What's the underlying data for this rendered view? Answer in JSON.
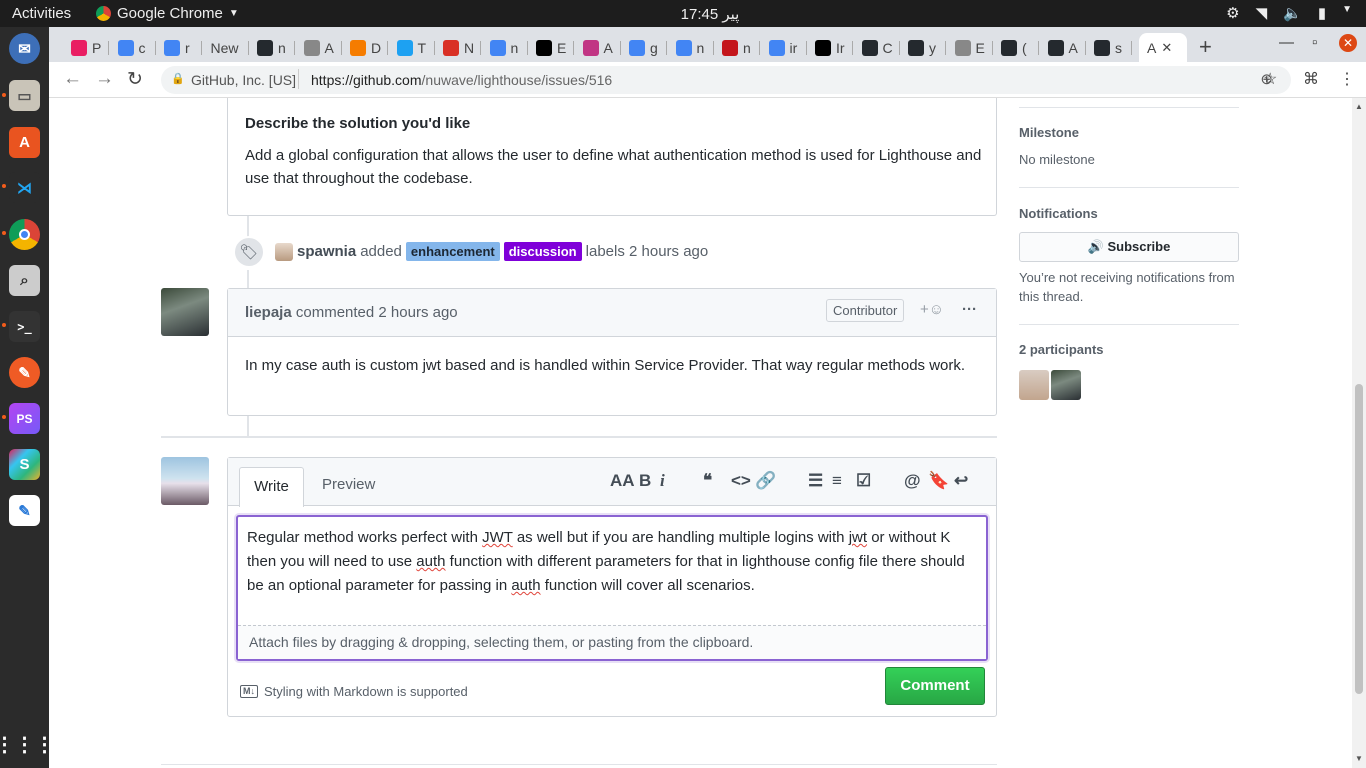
{
  "os": {
    "activities": "Activities",
    "app_name": "Google Chrome",
    "clock": "17:45 پير"
  },
  "browser": {
    "tabs": [
      {
        "label": "P",
        "color": "#e91e63"
      },
      {
        "label": "c",
        "color": "#4285f4"
      },
      {
        "label": "r",
        "color": "#4285f4"
      },
      {
        "label": "New",
        "color": ""
      },
      {
        "label": "n",
        "color": "#24292e"
      },
      {
        "label": "A",
        "color": "#888888"
      },
      {
        "label": "D",
        "color": "#f57c00"
      },
      {
        "label": "T",
        "color": "#1da1f2"
      },
      {
        "label": "N",
        "color": "#d93025"
      },
      {
        "label": "n",
        "color": "#4285f4"
      },
      {
        "label": "E",
        "color": "#000000"
      },
      {
        "label": "A",
        "color": "#c13584"
      },
      {
        "label": "g",
        "color": "#4285f4"
      },
      {
        "label": "n",
        "color": "#4285f4"
      },
      {
        "label": "n",
        "color": "#c4161c"
      },
      {
        "label": "ir",
        "color": "#4285f4"
      },
      {
        "label": "Ir",
        "color": "#000000"
      },
      {
        "label": "C",
        "color": "#24292e"
      },
      {
        "label": "y",
        "color": "#24292e"
      },
      {
        "label": "E",
        "color": "#888888"
      },
      {
        "label": "(",
        "color": "#24292e"
      },
      {
        "label": "A",
        "color": "#24292e"
      },
      {
        "label": "s",
        "color": "#24292e"
      }
    ],
    "active_tab": "A",
    "new_tab": "+",
    "org": "GitHub, Inc. [US]",
    "url_prefix": "https://github.com",
    "url_path": "/nuwave/lighthouse/issues/516"
  },
  "issue": {
    "solution_heading": "Describe the solution you'd like",
    "solution_text": "Add a global configuration that allows the user to define what authentication method is used for Lighthouse and use that throughout the codebase.",
    "label_event": {
      "user": "spawnia",
      "action": "added",
      "labels": [
        {
          "name": "enhancement",
          "bg": "#84b6eb",
          "fg": "#1c2733"
        },
        {
          "name": "discussion",
          "bg": "#7f00d9",
          "fg": "#ffffff"
        }
      ],
      "suffix": "labels 2 hours ago"
    },
    "comment": {
      "author": "liepaja",
      "meta": "commented 2 hours ago",
      "badge": "Contributor",
      "reaction": "+☺",
      "more": "···",
      "body": "In my case auth is custom jwt based and is handled within Service Provider. That way regular methods work."
    }
  },
  "editor": {
    "tab_write": "Write",
    "tab_preview": "Preview",
    "toolbar": [
      "AA",
      "B",
      "i",
      "❝",
      "<>",
      "🔗",
      "☰",
      "≡",
      "☑",
      "@",
      "🔖",
      "↩"
    ],
    "text_parts": [
      "Regular method works perfect with ",
      "JWT",
      " as well but if you are handling multiple logins with ",
      "jwt",
      " or without K then you will need to use ",
      "auth",
      " function with different parameters for that in lighthouse config file there should be an optional parameter for passing in ",
      "auth",
      " function will cover all scenarios."
    ],
    "attach_hint": "Attach files by dragging & dropping, selecting them, or pasting from the clipboard.",
    "markdown_note": "Styling with Markdown is supported",
    "markdown_logo": "M↓",
    "submit": "Comment"
  },
  "sidebar": {
    "milestone_title": "Milestone",
    "milestone_value": "No milestone",
    "notifications_title": "Notifications",
    "subscribe": "Subscribe",
    "notifications_text": "You’re not receiving notifications from this thread.",
    "participants_title": "2 participants"
  }
}
